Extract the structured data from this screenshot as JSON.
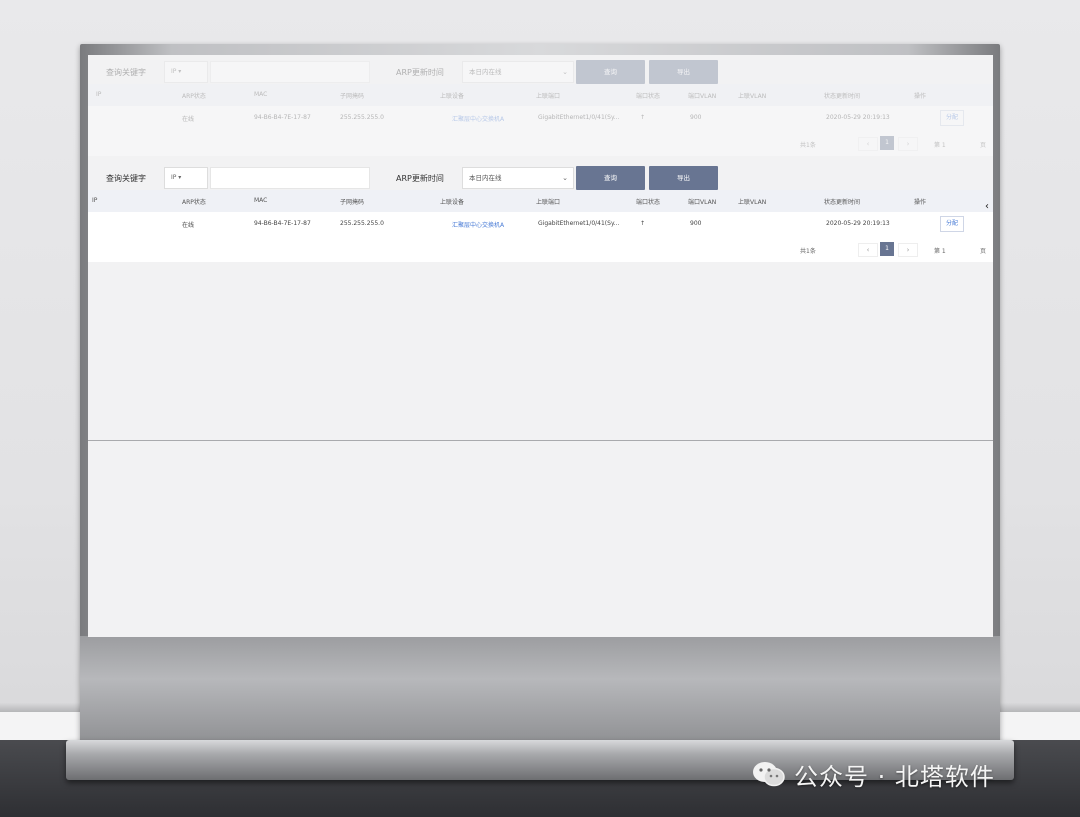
{
  "toolbar": {
    "keyword_label": "查询关键字",
    "keyword_type": "IP ▾",
    "keyword_value": "",
    "time_label": "ARP更新时间",
    "time_select": "本日内在线",
    "query_button": "查询",
    "export_button": "导出"
  },
  "table": {
    "columns": [
      "IP",
      "ARP状态",
      "MAC",
      "子网掩码",
      "上联设备",
      "上联端口",
      "端口状态",
      "端口VLAN",
      "上联VLAN",
      "状态更新时间",
      "操作"
    ],
    "rows": [
      {
        "ip": "",
        "arp_status": "在线",
        "mac": "94-B6-B4-7E-17-87",
        "mask": "255.255.255.0",
        "device": "汇聚层中心交换机A",
        "port": "GigabitEthernet1/0/41(Sy...",
        "port_status": "↑",
        "port_vlan": "900",
        "up_vlan": "",
        "update_time": "2020-05-29 20:19:13",
        "action": "分配"
      }
    ]
  },
  "pager": {
    "total": "共1条",
    "current": "1",
    "prev": "‹",
    "next": "›",
    "goto": "第 1",
    "suffix": "页"
  },
  "edge_glyph": "‹",
  "watermark": {
    "text": "公众号 · 北塔软件",
    "icon": "wechat-icon"
  },
  "colors": {
    "button": "#687592",
    "link": "#4a7cd6",
    "header": "#eff1f6"
  }
}
